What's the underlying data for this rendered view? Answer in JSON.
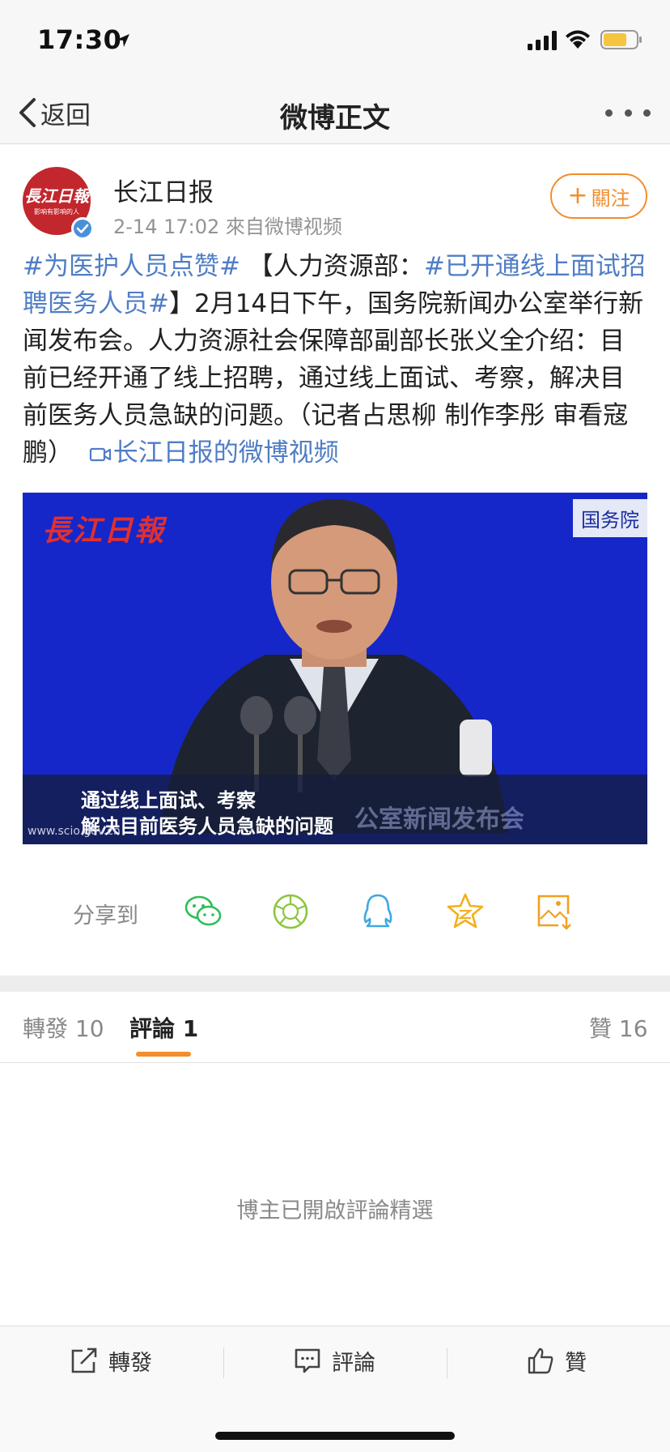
{
  "status_bar": {
    "time": "17:30",
    "icons": [
      "location-arrow-icon",
      "signal-icon",
      "wifi-icon",
      "battery-icon"
    ],
    "battery_color": "#f5c542"
  },
  "nav": {
    "back_label": "返回",
    "title": "微博正文",
    "more_icon": "more-dots-icon"
  },
  "author": {
    "name": "长江日报",
    "avatar_text": "長江日報",
    "avatar_subtext": "影响有影响的人",
    "meta": "2-14 17:02  來自微博视频",
    "follow_label": "關注",
    "verified_color": "#4a90d9"
  },
  "post": {
    "hashtag1": "#为医护人员点赞#",
    "text1": " 【人力资源部：",
    "hashtag2": "#已开通线上面试招聘医务人员#",
    "text2": "】2月14日下午，国务院新闻办公室举行新闻发布会。人力资源社会保障部副部长张义全介绍：目前已经开通了线上招聘，通过线上面试、考察，解决目前医务人员急缺的问题。（记者占思柳 制作李彤 审看寇鹏）",
    "video_link": "长江日报的微博视频"
  },
  "video": {
    "logo": "長江日報",
    "badge": "国务院",
    "caption_line1": "通过线上面试、考察",
    "caption_line2": "解决目前医务人员急缺的问题",
    "background_text": "公室新闻发布会",
    "url": "www.scio.gov.cn"
  },
  "share": {
    "label": "分享到",
    "targets": [
      "wechat-icon",
      "moments-icon",
      "qq-icon",
      "qzone-icon",
      "save-image-icon"
    ]
  },
  "tabs": [
    {
      "label": "轉發 10",
      "active": false
    },
    {
      "label": "評論 1",
      "active": true
    },
    {
      "label": "贊 16",
      "active": false
    }
  ],
  "comments": {
    "empty_note": "博主已開啟評論精選"
  },
  "bottom_bar": {
    "repost_label": "轉發",
    "comment_label": "評論",
    "like_label": "贊"
  },
  "colors": {
    "accent": "#f28e2b",
    "link": "#4f7dc6",
    "video_bg": "#1527c8"
  }
}
